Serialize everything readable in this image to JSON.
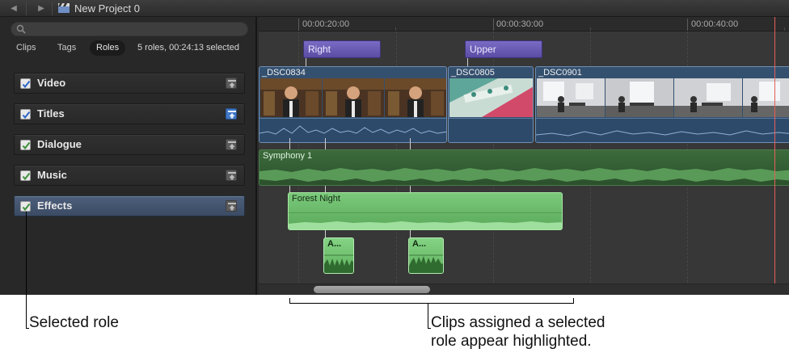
{
  "window": {
    "project_title": "New Project 0",
    "nav": {
      "back": "◀",
      "forward": "▶"
    }
  },
  "index": {
    "search": {
      "placeholder": "",
      "value": ""
    },
    "tabs": [
      {
        "label": "Clips",
        "selected": false
      },
      {
        "label": "Tags",
        "selected": false
      },
      {
        "label": "Roles",
        "selected": true
      }
    ],
    "summary": "5 roles, 00:24:13 selected",
    "roles": [
      {
        "label": "Video",
        "checked": true,
        "check_color": "#2f66c7",
        "lane_active": false,
        "selected": false
      },
      {
        "label": "Titles",
        "checked": true,
        "check_color": "#2f66c7",
        "lane_active": true,
        "selected": false
      },
      {
        "label": "Dialogue",
        "checked": true,
        "check_color": "#3f8f3c",
        "lane_active": false,
        "selected": false
      },
      {
        "label": "Music",
        "checked": true,
        "check_color": "#3f8f3c",
        "lane_active": false,
        "selected": false
      },
      {
        "label": "Effects",
        "checked": true,
        "check_color": "#3f8f3c",
        "lane_active": false,
        "selected": true
      }
    ]
  },
  "timeline": {
    "ruler_labels": [
      "00:00:20:00",
      "00:00:30:00",
      "00:00:40:00"
    ],
    "titles": [
      {
        "label": "Right"
      },
      {
        "label": "Upper"
      }
    ],
    "video_clips": [
      {
        "name": "_DSC0834"
      },
      {
        "name": "_DSC0805"
      },
      {
        "name": "_DSC0901"
      }
    ],
    "audio_clips": [
      {
        "name": "Symphony 1",
        "highlighted": false
      },
      {
        "name": "Forest Night",
        "highlighted": true
      },
      {
        "name": "A...",
        "highlighted": true
      },
      {
        "name": "A...",
        "highlighted": true
      }
    ]
  },
  "annotations": {
    "selected_role": "Selected role",
    "clips_highlight_line1": "Clips assigned a selected",
    "clips_highlight_line2": "role appear highlighted."
  },
  "colors": {
    "title_clip": "#6a5bb6",
    "video_clip": "#34506f",
    "audio_clip": "#3c6b3c",
    "audio_highlight": "#6cbc6c",
    "playhead": "#e4605a",
    "selected_row": "#44556f"
  }
}
